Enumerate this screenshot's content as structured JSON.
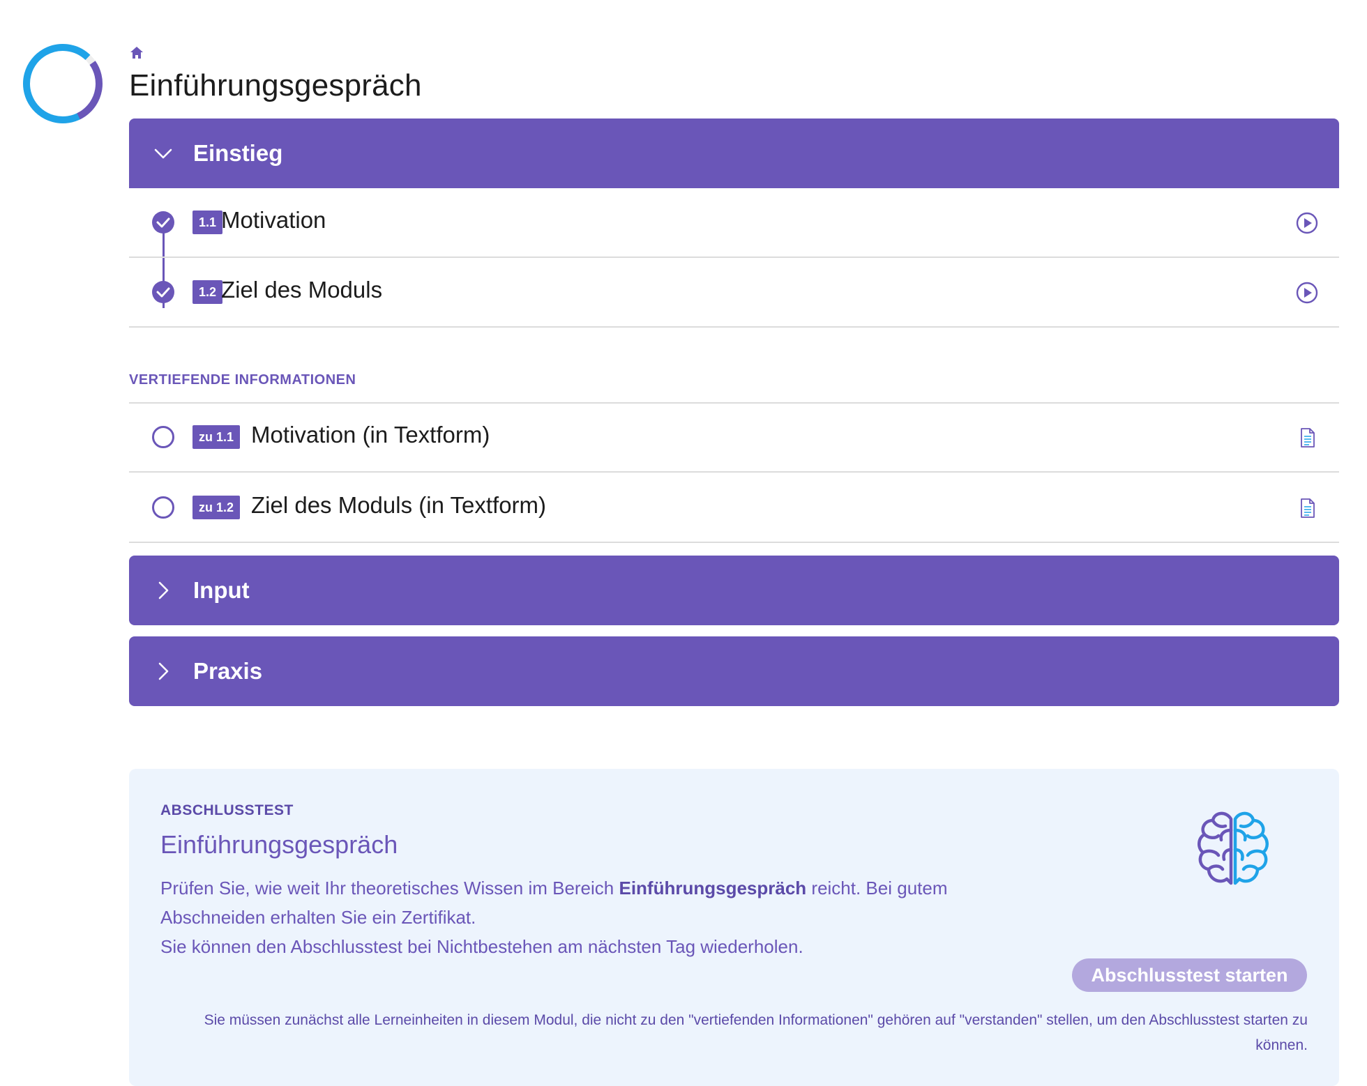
{
  "page": {
    "title": "Einführungsgespräch",
    "progress_fraction": 0.35
  },
  "colors": {
    "accent": "#6a56b8",
    "progress_blue": "#1fa3e8",
    "final_box_bg": "#edf4fd",
    "button_disabled": "#b3a8de"
  },
  "sections": [
    {
      "label": "Einstieg",
      "expanded": true
    },
    {
      "label": "Input",
      "expanded": false
    },
    {
      "label": "Praxis",
      "expanded": false
    }
  ],
  "units": [
    {
      "badge": "1.1",
      "title": "Motivation",
      "status": "completed",
      "icon": "play-icon"
    },
    {
      "badge": "1.2",
      "title": "Ziel des Moduls",
      "status": "completed",
      "icon": "play-icon"
    }
  ],
  "deepening": {
    "heading": "VERTIEFENDE INFORMATIONEN",
    "items": [
      {
        "badge": "zu 1.1",
        "title": "Motivation (in Textform)",
        "status": "open",
        "icon": "document-icon"
      },
      {
        "badge": "zu 1.2",
        "title": "Ziel des Moduls (in Textform)",
        "status": "open",
        "icon": "document-icon"
      }
    ]
  },
  "final_test": {
    "eyebrow": "ABSCHLUSSTEST",
    "title": "Einführungsgespräch",
    "desc_part1": "Prüfen Sie, wie weit Ihr theoretisches Wissen im Bereich ",
    "desc_bold": "Einführungsgespräch",
    "desc_part2": " reicht. Bei gutem Abschneiden erhalten Sie ein Zertifikat.",
    "desc_line2": "Sie können den Abschlusstest bei Nichtbestehen am nächsten Tag wiederholen.",
    "button_label": "Abschlusstest starten",
    "button_disabled": true,
    "notice": "Sie müssen zunächst alle Lerneinheiten in diesem Modul, die nicht zu den \"vertiefenden Informationen\" gehören auf \"verstanden\" stellen, um den Abschlusstest starten zu können.",
    "icon": "brain-icon"
  }
}
